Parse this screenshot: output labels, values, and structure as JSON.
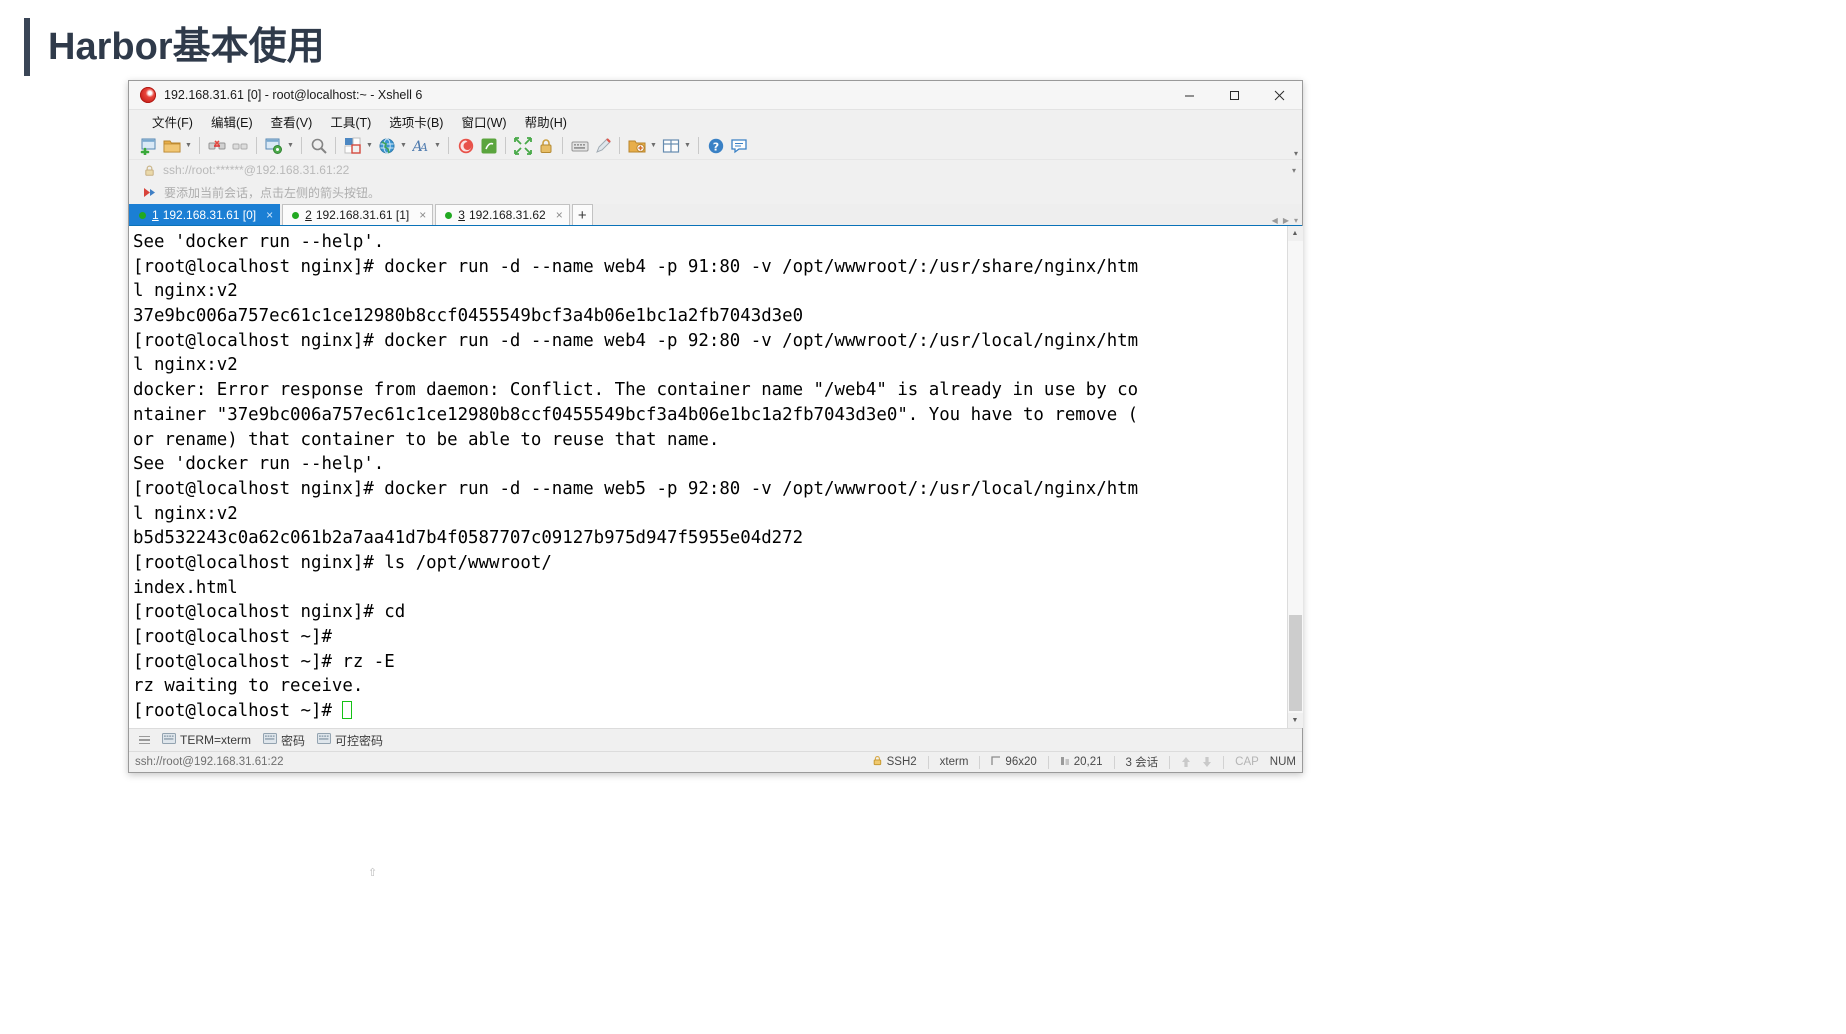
{
  "slide": {
    "title": "Harbor基本使用",
    "accent_color": "#3a4556",
    "footer_marker": "⇧"
  },
  "window": {
    "title": "192.168.31.61 [0] - root@localhost:~ - Xshell 6",
    "app_icon": "xshell-logo-icon",
    "controls": {
      "minimize": "minimize-icon",
      "maximize": "maximize-icon",
      "close": "close-icon"
    }
  },
  "menubar": {
    "items": [
      {
        "label": "文件(F)"
      },
      {
        "label": "编辑(E)"
      },
      {
        "label": "查看(V)"
      },
      {
        "label": "工具(T)"
      },
      {
        "label": "选项卡(B)"
      },
      {
        "label": "窗口(W)"
      },
      {
        "label": "帮助(H)"
      }
    ]
  },
  "toolbar": {
    "overflow_caret": "▾",
    "items": [
      {
        "icon": "new-session-icon"
      },
      {
        "icon": "open-folder-icon",
        "caret": true
      },
      {
        "sep": true
      },
      {
        "icon": "disconnect-icon"
      },
      {
        "icon": "reconnect-icon"
      },
      {
        "sep": true
      },
      {
        "icon": "session-properties-icon",
        "caret": true
      },
      {
        "sep": true
      },
      {
        "icon": "find-icon"
      },
      {
        "sep": true
      },
      {
        "icon": "color-scheme-icon",
        "caret": true
      },
      {
        "icon": "globe-icon",
        "caret": true
      },
      {
        "icon": "font-icon",
        "caret": true
      },
      {
        "sep": true
      },
      {
        "icon": "xshell-icon"
      },
      {
        "icon": "xftp-icon"
      },
      {
        "sep": true
      },
      {
        "icon": "fullscreen-icon"
      },
      {
        "icon": "lock-icon"
      },
      {
        "sep": true
      },
      {
        "icon": "keyboard-icon"
      },
      {
        "icon": "highlight-pen-icon"
      },
      {
        "sep": true
      },
      {
        "icon": "transfer-icon",
        "caret": true
      },
      {
        "icon": "split-layout-icon",
        "caret": true
      },
      {
        "sep": true
      },
      {
        "icon": "help-icon"
      },
      {
        "icon": "feedback-icon"
      }
    ]
  },
  "addressbar": {
    "lock_icon": "lock-icon",
    "value": "ssh://root:******@192.168.31.61:22",
    "caret": "▾"
  },
  "bookmark_hint": {
    "arrow_icon": "red-arrow-icon",
    "text": "要添加当前会话，点击左侧的箭头按钮。"
  },
  "tabs": {
    "items": [
      {
        "num": "1",
        "label": "192.168.31.61 [0]",
        "active": true,
        "status_color": "#21a921",
        "close": "×"
      },
      {
        "num": "2",
        "label": "192.168.31.61 [1]",
        "active": false,
        "status_color": "#21a921",
        "close": "×"
      },
      {
        "num": "3",
        "label": "192.168.31.62",
        "active": false,
        "status_color": "#21a921",
        "close": "×"
      }
    ],
    "add_label": "+",
    "nav_left": "◀",
    "nav_right": "▶",
    "nav_menu": "▾",
    "active_color": "#1b7fd4"
  },
  "terminal": {
    "lines": [
      "See 'docker run --help'.",
      "[root@localhost nginx]# docker run -d --name web4 -p 91:80 -v /opt/wwwroot/:/usr/share/nginx/htm",
      "l nginx:v2",
      "37e9bc006a757ec61c1ce12980b8ccf0455549bcf3a4b06e1bc1a2fb7043d3e0",
      "[root@localhost nginx]# docker run -d --name web4 -p 92:80 -v /opt/wwwroot/:/usr/local/nginx/htm",
      "l nginx:v2",
      "docker: Error response from daemon: Conflict. The container name \"/web4\" is already in use by co",
      "ntainer \"37e9bc006a757ec61c1ce12980b8ccf0455549bcf3a4b06e1bc1a2fb7043d3e0\". You have to remove (",
      "or rename) that container to be able to reuse that name.",
      "See 'docker run --help'.",
      "[root@localhost nginx]# docker run -d --name web5 -p 92:80 -v /opt/wwwroot/:/usr/local/nginx/htm",
      "l nginx:v2",
      "b5d532243c0a62c061b2a7aa41d7b4f0587707c09127b975d947f5955e04d272",
      "[root@localhost nginx]# ls /opt/wwwroot/",
      "index.html",
      "[root@localhost nginx]# cd",
      "[root@localhost ~]#",
      "[root@localhost ~]# rz -E",
      "rz waiting to receive.",
      "[root@localhost ~]# "
    ],
    "cursor_color": "#15c115",
    "scroll_up": "▲",
    "scroll_down": "▼"
  },
  "quickbar": {
    "grip": "drag-grip-icon",
    "buttons": [
      {
        "icon": "keyboard-icon",
        "label": "TERM=xterm"
      },
      {
        "icon": "keyboard-icon",
        "label": "密码"
      },
      {
        "icon": "keyboard-icon",
        "label": "可控密码"
      }
    ]
  },
  "statusbar": {
    "left": "ssh://root@192.168.31.61:22",
    "protocol_icon": "lock-icon",
    "protocol": "SSH2",
    "term": "xterm",
    "size_icon": "terminal-size-icon",
    "size": "96x20",
    "cursor_icon": "cursor-pos-icon",
    "cursor": "20,21",
    "sessions": "3 会话",
    "upload_icon": "upload-arrow-icon",
    "download_icon": "download-arrow-icon",
    "caps": "CAP",
    "num": "NUM"
  }
}
